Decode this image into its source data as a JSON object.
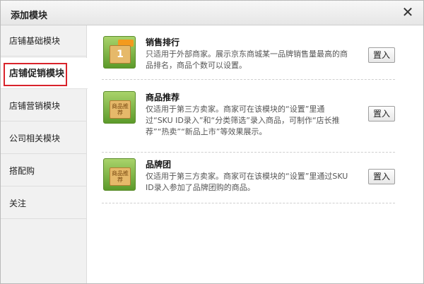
{
  "dialog": {
    "title": "添加模块",
    "close_glyph": "✕"
  },
  "sidebar": {
    "items": [
      {
        "label": "店铺基础模块"
      },
      {
        "label": "店铺促销模块"
      },
      {
        "label": "店铺营销模块"
      },
      {
        "label": "公司相关模块"
      },
      {
        "label": "搭配购"
      },
      {
        "label": "关注"
      }
    ],
    "active_index": 1,
    "highlight_color": "#d9232b"
  },
  "modules": [
    {
      "title": "销售排行",
      "description": "只适用于外部商家。展示京东商城某一品牌销售量最高的商品排名，商品个数可以设置。",
      "button": "置入",
      "thumb_icon": "sales-rank-thumb-icon",
      "thumb_text": "1"
    },
    {
      "title": "商品推荐",
      "description": "仅适用于第三方卖家。商家可在该模块的“设置”里通过“SKU ID录入”和“分类筛选”录入商品，可制作“店长推荐”“热卖”“新品上市”等效果展示。",
      "button": "置入",
      "thumb_icon": "product-recommend-thumb-icon",
      "thumb_text": "商品推荐"
    },
    {
      "title": "品牌团",
      "description": "仅适用于第三方卖家。商家可在该模块的“设置”里通过SKU ID录入参加了品牌团购的商品。",
      "button": "置入",
      "thumb_icon": "brand-group-thumb-icon",
      "thumb_text": "商品推荐"
    }
  ]
}
